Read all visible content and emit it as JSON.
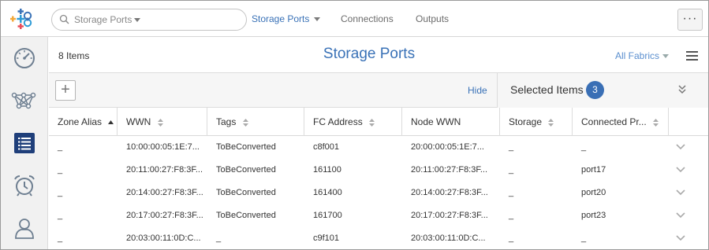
{
  "topbar": {
    "search_text": "Storage Ports",
    "nav": [
      {
        "label": "Storage Ports"
      },
      {
        "label": "Connections"
      },
      {
        "label": "Outputs"
      }
    ],
    "more_label": "···"
  },
  "sidebar": {
    "items": [
      {
        "icon": "dashboard-gauge-icon"
      },
      {
        "icon": "network-topology-icon"
      },
      {
        "icon": "list-icon",
        "active": true
      },
      {
        "icon": "alarm-clock-icon"
      },
      {
        "icon": "user-icon"
      }
    ]
  },
  "header": {
    "count": "8 Items",
    "title": "Storage Ports",
    "fabric_filter": "All Fabrics"
  },
  "toolbar": {
    "add_label": "+",
    "hide_label": "Hide",
    "selected_label": "Selected Items",
    "selected_count": "3"
  },
  "table": {
    "columns": [
      "Zone Alias",
      "WWN",
      "Tags",
      "FC Address",
      "Node WWN",
      "Storage",
      "Connected Pr..."
    ],
    "rows": [
      [
        "_",
        "10:00:00:05:1E:7...",
        "ToBeConverted",
        "c8f001",
        "20:00:00:05:1E:7...",
        "_",
        "_"
      ],
      [
        "_",
        "20:11:00:27:F8:3F...",
        "ToBeConverted",
        "161100",
        "20:11:00:27:F8:3F...",
        "_",
        "port17"
      ],
      [
        "_",
        "20:14:00:27:F8:3F...",
        "ToBeConverted",
        "161400",
        "20:14:00:27:F8:3F...",
        "_",
        "port20"
      ],
      [
        "_",
        "20:17:00:27:F8:3F...",
        "ToBeConverted",
        "161700",
        "20:17:00:27:F8:3F...",
        "_",
        "port23"
      ],
      [
        "_",
        "20:03:00:11:0D:C...",
        "_",
        "c9f101",
        "20:03:00:11:0D:C...",
        "_",
        "_"
      ]
    ]
  },
  "colors": {
    "accent": "#3a72b7",
    "sidebar_active": "#1f3f7a",
    "icon_gray": "#6e7f91",
    "badge": "#3a6fb5"
  }
}
